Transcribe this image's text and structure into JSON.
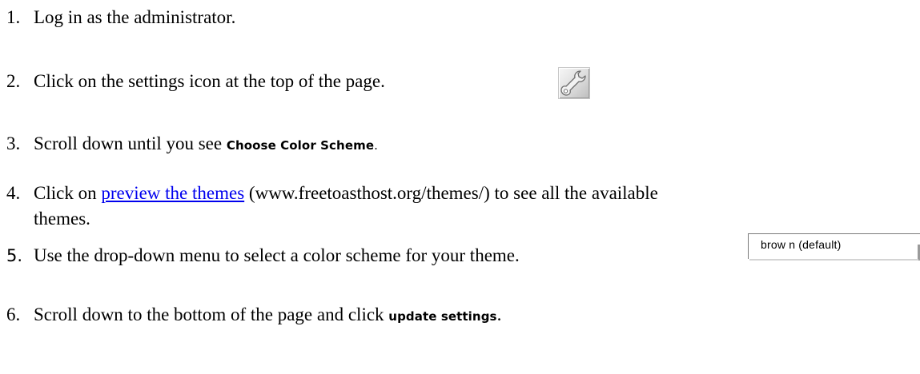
{
  "steps": [
    {
      "num": "1.",
      "text": "Log in as the administrator."
    },
    {
      "num": "2.",
      "text": "Click on the settings icon at the top of the page."
    },
    {
      "num": "3.",
      "text": "Scroll down until you see ",
      "ui_label": "Choose Color Scheme",
      "suffix": "."
    },
    {
      "num": "4.",
      "prefix": "Click on ",
      "link": "preview the themes",
      "text": " (www.freetoasthost.org/themes/) to see all the available",
      "continuation": "themes."
    },
    {
      "num": "5.",
      "text": "Use the drop-down menu to select a color scheme for your theme."
    },
    {
      "num": "6.",
      "text": "Scroll down to the bottom of the page and click ",
      "ui_label": "update settings",
      "suffix": "."
    }
  ],
  "settings_icon": {
    "icon": "wrench-icon"
  },
  "dropdown": {
    "selected": "brow n (default)"
  },
  "colors": {
    "link": "#0000ee",
    "text": "#000000",
    "background": "#ffffff"
  }
}
